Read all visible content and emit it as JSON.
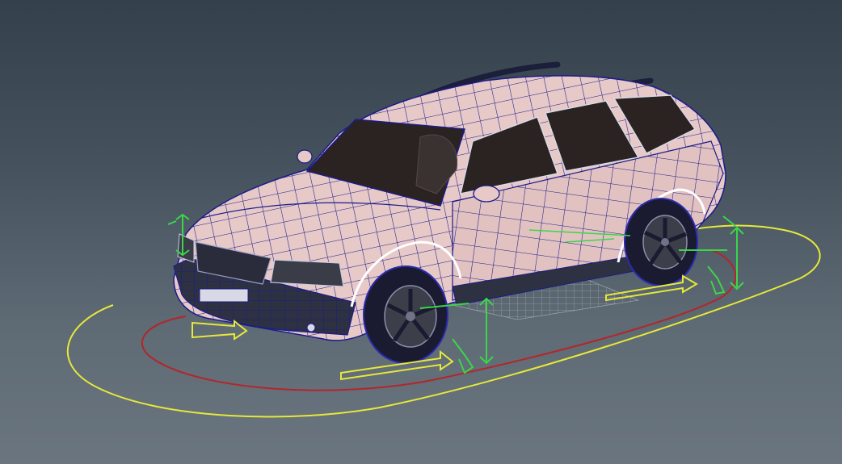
{
  "viewport": {
    "background_top": "#34404b",
    "background_bottom": "#6a7580"
  },
  "car": {
    "body_color": "#e7c9c8",
    "wire_color": "#1b1c8a",
    "glass_color": "#2a2322",
    "tire_color": "#1a1a30"
  },
  "rig": {
    "outer_ring_color": "#e6e83a",
    "inner_ring_color": "#b3262a",
    "arrow_color": "#e6e83a",
    "handle_color": "#3bd64a"
  }
}
